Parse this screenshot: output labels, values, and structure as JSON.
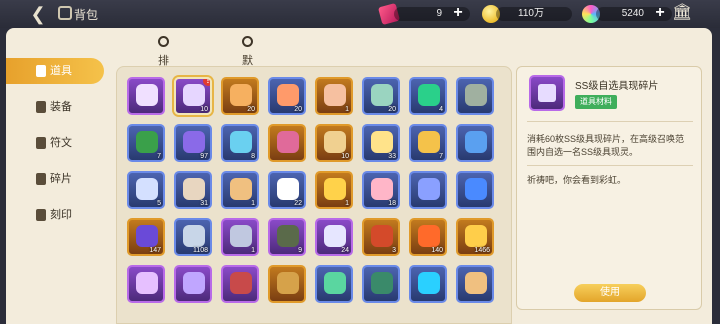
{
  "topbar": {
    "title": "背包",
    "back_icon": "back-arrow-icon",
    "bag_icon": "bag-icon",
    "resources": [
      {
        "name": "ticket",
        "icon": "ticket-icon",
        "value": "9"
      },
      {
        "name": "gold",
        "icon": "gold-coin-icon",
        "value": "110万"
      },
      {
        "name": "gem",
        "icon": "rainbow-gem-icon",
        "value": "5240"
      }
    ],
    "bank_icon": "bank-icon"
  },
  "sortbar": {
    "sort_label": "排序",
    "default_label": "默认"
  },
  "categories": [
    {
      "label": "道具",
      "icon": "bottle-icon",
      "active": true
    },
    {
      "label": "装备",
      "icon": "sword-icon",
      "active": false
    },
    {
      "label": "符文",
      "icon": "rune-icon",
      "active": false
    },
    {
      "label": "碎片",
      "icon": "shard-icon",
      "active": false
    },
    {
      "label": "刻印",
      "icon": "seal-icon",
      "active": false
    }
  ],
  "items": [
    {
      "rarity": "purple",
      "qty": "",
      "color": "#f0e0ff"
    },
    {
      "rarity": "purple",
      "qty": "10",
      "color": "#e6d6ff",
      "selected": true,
      "badge": "!"
    },
    {
      "rarity": "orange",
      "qty": "20",
      "color": "#f6b060"
    },
    {
      "rarity": "blue",
      "qty": "20",
      "color": "#ff9a6a"
    },
    {
      "rarity": "orange",
      "qty": "1",
      "color": "#f6c0a0"
    },
    {
      "rarity": "blue",
      "qty": "20",
      "color": "#9ad4c0"
    },
    {
      "rarity": "blue",
      "qty": "4",
      "color": "#2ad08a"
    },
    {
      "rarity": "blue",
      "qty": "",
      "color": "#a0b0a0"
    },
    {
      "rarity": "blue",
      "qty": "7",
      "color": "#3aa04a"
    },
    {
      "rarity": "blue",
      "qty": "97",
      "color": "#8a6ae8"
    },
    {
      "rarity": "blue",
      "qty": "8",
      "color": "#6ad0f0"
    },
    {
      "rarity": "orange",
      "qty": "",
      "color": "#e06a9a"
    },
    {
      "rarity": "orange",
      "qty": "10",
      "color": "#f0d090"
    },
    {
      "rarity": "blue",
      "qty": "33",
      "color": "#ffe38a"
    },
    {
      "rarity": "blue",
      "qty": "7",
      "color": "#f4c24a"
    },
    {
      "rarity": "blue",
      "qty": "",
      "color": "#5aa0f0"
    },
    {
      "rarity": "blue",
      "qty": "5",
      "color": "#d4e0ff"
    },
    {
      "rarity": "blue",
      "qty": "31",
      "color": "#e8d6c0"
    },
    {
      "rarity": "blue",
      "qty": "1",
      "color": "#f0c080"
    },
    {
      "rarity": "blue",
      "qty": "22",
      "color": "#ffffff"
    },
    {
      "rarity": "orange",
      "qty": "1",
      "color": "#ffd24a"
    },
    {
      "rarity": "blue",
      "qty": "18",
      "color": "#ffb6c8"
    },
    {
      "rarity": "blue",
      "qty": "",
      "color": "#8aa0ff"
    },
    {
      "rarity": "blue",
      "qty": "",
      "color": "#4a8aff"
    },
    {
      "rarity": "orange",
      "qty": "147",
      "color": "#6a4ad8"
    },
    {
      "rarity": "blue",
      "qty": "1108",
      "color": "#c8d6e8"
    },
    {
      "rarity": "purple",
      "qty": "1",
      "color": "#c0c8e0"
    },
    {
      "rarity": "purple",
      "qty": "9",
      "color": "#5a6a4a"
    },
    {
      "rarity": "purple",
      "qty": "24",
      "color": "#e6e6ff"
    },
    {
      "rarity": "orange",
      "qty": "3",
      "color": "#d44a2a"
    },
    {
      "rarity": "orange",
      "qty": "140",
      "color": "#ff6a2a"
    },
    {
      "rarity": "orange",
      "qty": "1466",
      "color": "#ffce4a"
    },
    {
      "rarity": "purple",
      "qty": "",
      "color": "#e6c0ff"
    },
    {
      "rarity": "purple",
      "qty": "",
      "color": "#c0a6ff"
    },
    {
      "rarity": "purple",
      "qty": "",
      "color": "#c84a4a"
    },
    {
      "rarity": "orange",
      "qty": "",
      "color": "#d6a24a"
    },
    {
      "rarity": "blue",
      "qty": "",
      "color": "#5ad6a0"
    },
    {
      "rarity": "blue",
      "qty": "",
      "color": "#3a8a6a"
    },
    {
      "rarity": "blue",
      "qty": "",
      "color": "#2ad0ff"
    },
    {
      "rarity": "blue",
      "qty": "",
      "color": "#f0c080"
    }
  ],
  "detail": {
    "name": "SS级自选具现碎片",
    "tag": "道具材料",
    "desc": "消耗60枚SS级具现碎片，在高级召唤范围内自选一名SS级具现灵。",
    "flavor": "祈祷吧，你会看到彩虹。",
    "use_label": "使用"
  }
}
